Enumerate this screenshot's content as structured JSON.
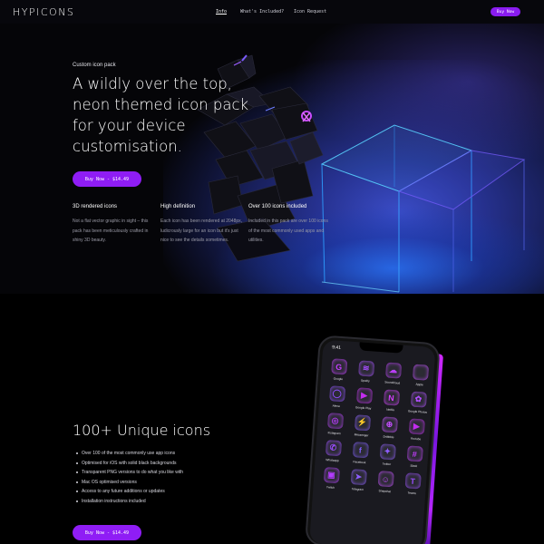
{
  "nav": {
    "logo": "HYPICONS",
    "links": [
      "Info",
      "What's Included?",
      "Icon Request"
    ],
    "buy_label": "Buy Now"
  },
  "hero": {
    "eyebrow": "Custom icon pack",
    "title": "A wildly over the top, neon themed icon pack for your device customisation.",
    "buy_label": "Buy Now - $14.49",
    "features": [
      {
        "title": "3D rendered icons",
        "text": "Not a flat vector graphic in sight – this pack has been meticulously crafted in shiny 3D beauty."
      },
      {
        "title": "High definition",
        "text": "Each icon has been rendered at 2048px, ludicrously large for an icon but it's just nice to see the details sometimes."
      },
      {
        "title": "Over 100 icons included",
        "text": "Included in this pack are over 100 icons of the most commonly used apps and utilities."
      }
    ]
  },
  "section2": {
    "title": "100+ Unique icons",
    "list": [
      "Over 100 of the most commonly use app icons",
      "Optimised for iOS with solid black backgrounds",
      "Transparent PNG versions to do what you like with",
      "Mac OS optimised versions",
      "Access to any future additions or updates",
      "Installation instructions included"
    ],
    "buy_label": "Buy Now - $14.49"
  },
  "phone": {
    "time": "9:41",
    "apps": [
      {
        "name": "Google",
        "icon": "google-icon",
        "glyph": "G",
        "color": "#c33cff"
      },
      {
        "name": "Spotify",
        "icon": "spotify-icon",
        "glyph": "≋",
        "color": "#a54cff"
      },
      {
        "name": "Soundcloud",
        "icon": "soundcloud-icon",
        "glyph": "☁",
        "color": "#b83ef5"
      },
      {
        "name": "Apple",
        "icon": "apple-icon",
        "glyph": "",
        "color": "#c34fff"
      },
      {
        "name": "Alexa",
        "icon": "alexa-icon",
        "glyph": "◯",
        "color": "#8f4cff"
      },
      {
        "name": "Google Play",
        "icon": "google-play-icon",
        "glyph": "▶",
        "color": "#c42cf0"
      },
      {
        "name": "Netflix",
        "icon": "netflix-icon",
        "glyph": "N",
        "color": "#d43cff"
      },
      {
        "name": "Google Photos",
        "icon": "google-photos-icon",
        "glyph": "✿",
        "color": "#b04cff"
      },
      {
        "name": "Instagram",
        "icon": "instagram-icon",
        "glyph": "◎",
        "color": "#b23cf5"
      },
      {
        "name": "Messenger",
        "icon": "messenger-icon",
        "glyph": "⚡",
        "color": "#8a5cff"
      },
      {
        "name": "Dribbble",
        "icon": "dribbble-icon",
        "glyph": "⊕",
        "color": "#c44cff"
      },
      {
        "name": "Youtube",
        "icon": "youtube-icon",
        "glyph": "▶",
        "color": "#c22cf0"
      },
      {
        "name": "Whatsapp",
        "icon": "whatsapp-icon",
        "glyph": "✆",
        "color": "#9a4cff"
      },
      {
        "name": "Facebook",
        "icon": "facebook-icon",
        "glyph": "f",
        "color": "#7f5cff"
      },
      {
        "name": "Twitter",
        "icon": "twitter-icon",
        "glyph": "✦",
        "color": "#8f5cff"
      },
      {
        "name": "Slack",
        "icon": "slack-icon",
        "glyph": "#",
        "color": "#c33cff"
      },
      {
        "name": "Twitch",
        "icon": "twitch-icon",
        "glyph": "▣",
        "color": "#b43cff"
      },
      {
        "name": "Telegram",
        "icon": "telegram-icon",
        "glyph": "➤",
        "color": "#8d5cff"
      },
      {
        "name": "Snapchat",
        "icon": "snapchat-icon",
        "glyph": "☺",
        "color": "#c44cff"
      },
      {
        "name": "Teams",
        "icon": "teams-icon",
        "glyph": "T",
        "color": "#9a4cff"
      }
    ]
  },
  "colors": {
    "accent": "#8f1df5",
    "background": "#000000",
    "glow_blue": "#2f6bff"
  }
}
